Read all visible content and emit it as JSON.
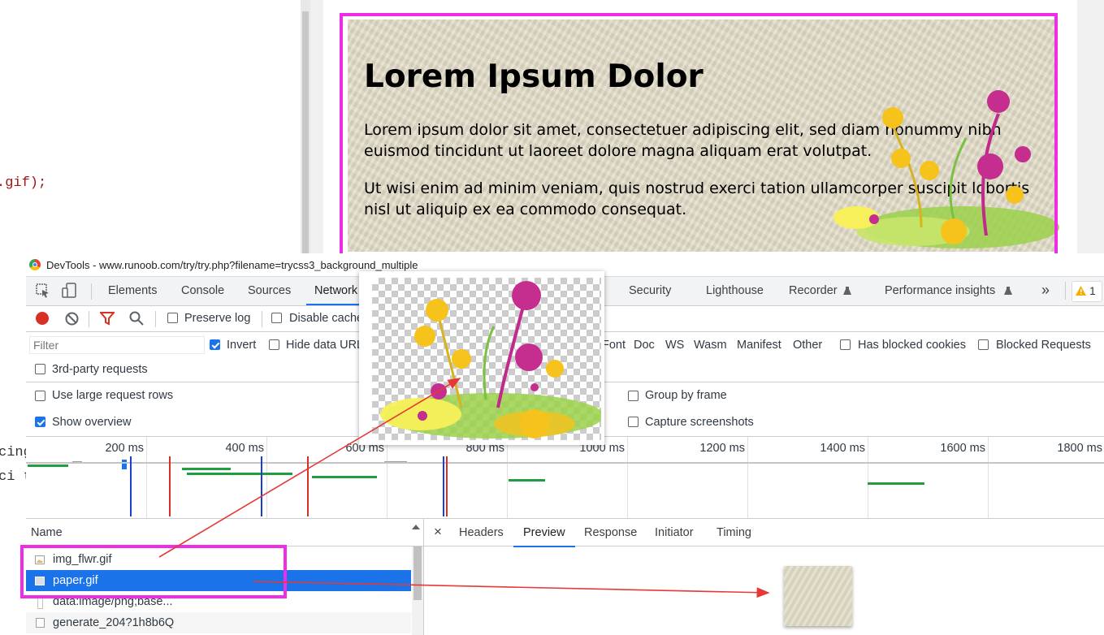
{
  "editor": {
    "line1": ".gif);",
    "line2": "cing",
    "line3": "ci t"
  },
  "preview": {
    "heading": "Lorem Ipsum Dolor",
    "para1": "Lorem ipsum dolor sit amet, consectetuer adipiscing elit, sed diam nonummy nibh euismod tincidunt ut laoreet dolore magna aliquam erat volutpat.",
    "para2": "Ut wisi enim ad minim veniam, quis nostrud exerci tation ullamcorper suscipit lobortis nisl ut aliquip ex ea commodo consequat."
  },
  "devtools": {
    "title": "DevTools - www.runoob.com/try/try.php?filename=trycss3_background_multiple",
    "tabs": [
      "Elements",
      "Console",
      "Sources",
      "Network",
      "Security",
      "Lighthouse",
      "Recorder",
      "Performance insights"
    ],
    "more_label": "»",
    "warning_count": "1",
    "toolbar": {
      "preserve_log": "Preserve log",
      "disable_cache": "Disable cache"
    },
    "filter": {
      "placeholder": "Filter",
      "invert": "Invert",
      "hide_data_urls": "Hide data URL",
      "types": [
        "Font",
        "Doc",
        "WS",
        "Wasm",
        "Manifest",
        "Other"
      ],
      "has_blocked_cookies": "Has blocked cookies",
      "blocked_requests": "Blocked Requests",
      "third_party": "3rd-party requests"
    },
    "settings": {
      "large_rows": "Use large request rows",
      "show_overview": "Show overview",
      "group_by_frame": "Group by frame",
      "capture_screenshots": "Capture screenshots"
    },
    "overview_ticks": [
      "200 ms",
      "400 ms",
      "600 ms",
      "800 ms",
      "1000 ms",
      "1200 ms",
      "1400 ms",
      "1600 ms",
      "1800 ms"
    ],
    "list_header": "Name",
    "requests": [
      "img_flwr.gif",
      "paper.gif",
      "data:image/png;base...",
      "generate_204?1h8b6Q"
    ],
    "detail_tabs": [
      "Headers",
      "Preview",
      "Response",
      "Initiator",
      "Timing"
    ],
    "close_label": "×"
  },
  "colors": {
    "highlight": "#ee2ee6",
    "accent": "#1a73e8",
    "arrow": "#e53935"
  }
}
